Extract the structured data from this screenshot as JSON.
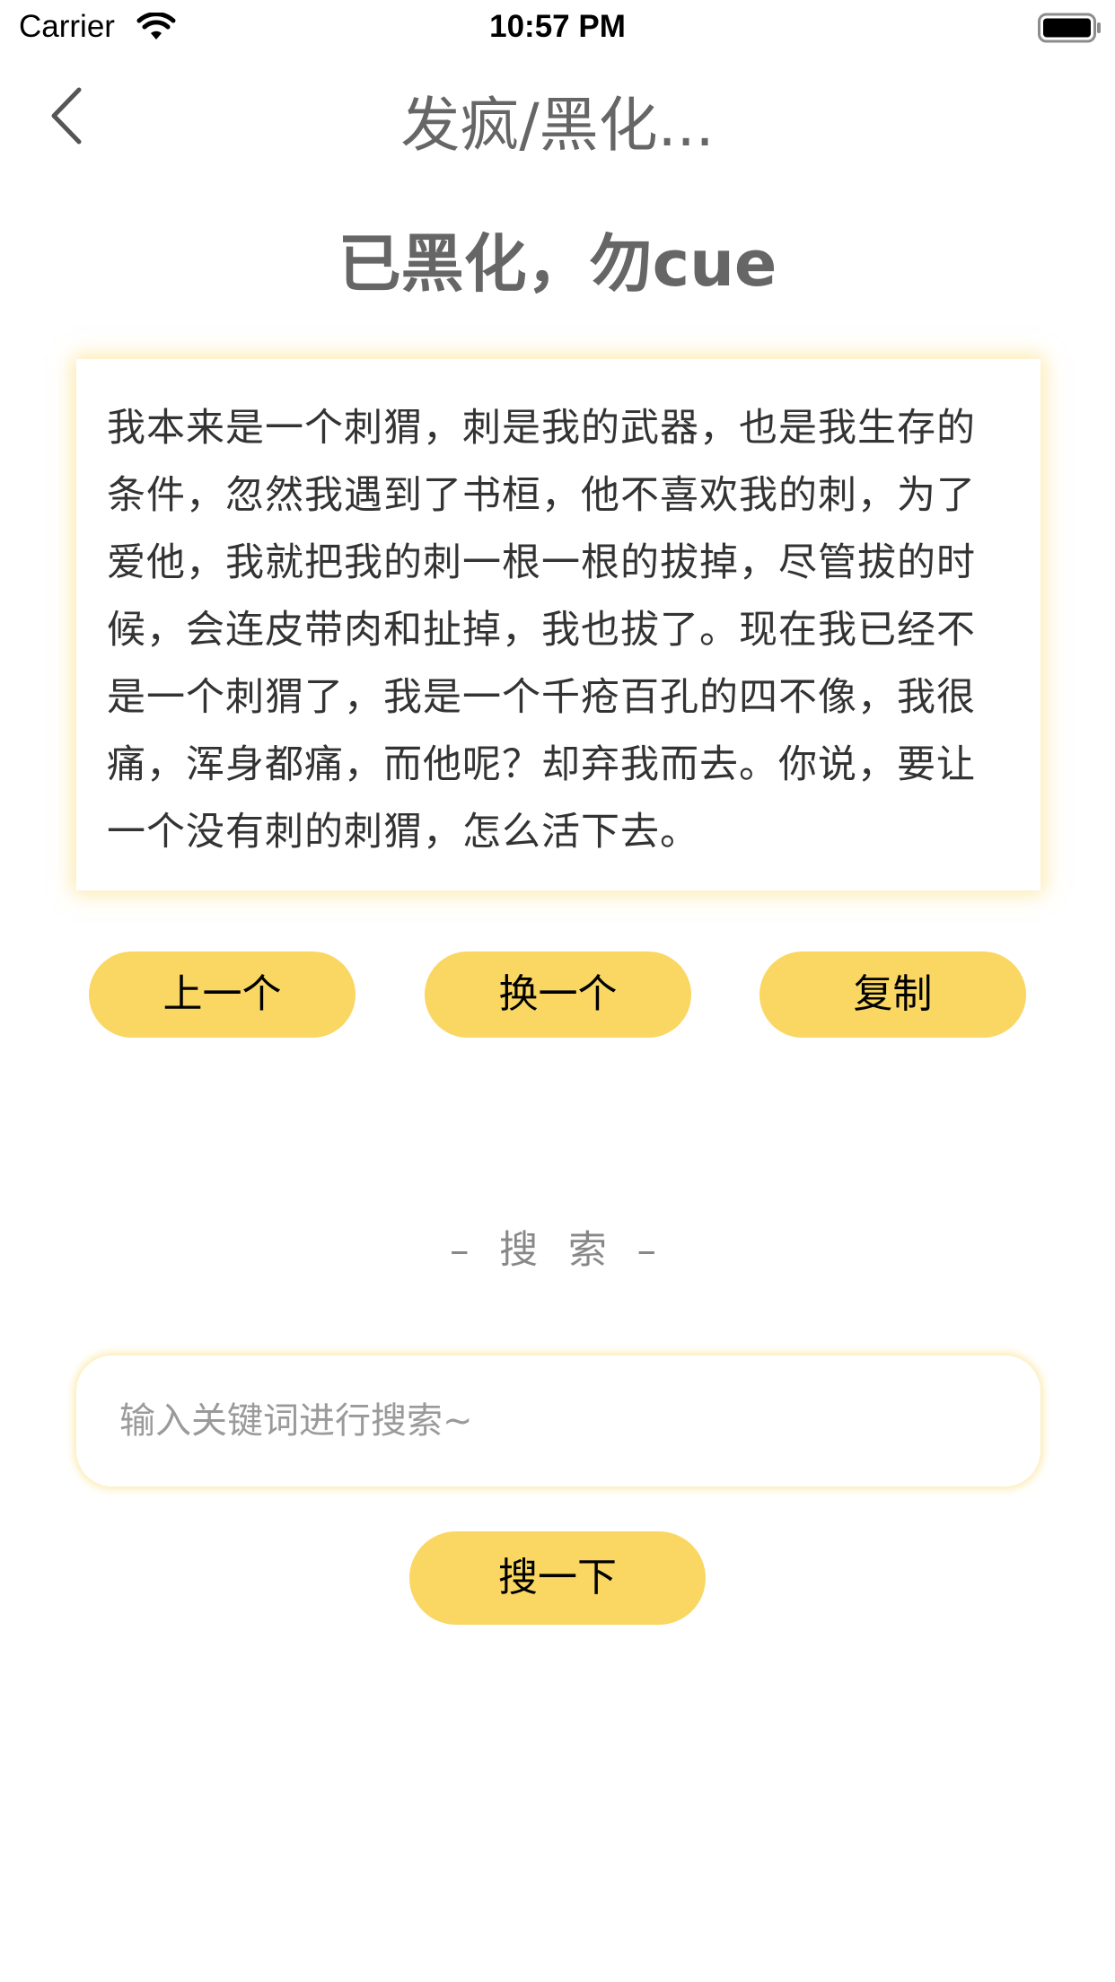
{
  "status_bar": {
    "carrier": "Carrier",
    "time": "10:57 PM"
  },
  "nav": {
    "title": "发疯/黑化...",
    "back_icon": "chevron-left-icon"
  },
  "heading": "已黑化，勿cue",
  "quote": {
    "text": "我本来是一个刺猬，刺是我的武器，也是我生存的条件，忽然我遇到了书桓，他不喜欢我的刺，为了爱他，我就把我的刺一根一根的拔掉，尽管拔的时候，会连皮带肉和扯掉，我也拔了。现在我已经不是一个刺猬了，我是一个千疮百孔的四不像，我很痛，浑身都痛，而他呢？却弃我而去。你说，要让一个没有刺的刺猬，怎么活下去。"
  },
  "actions": {
    "prev": "上一个",
    "next": "换一个",
    "copy": "复制"
  },
  "search": {
    "section_title": "– 搜 索 –",
    "placeholder": "输入关键词进行搜索~",
    "value": "",
    "button": "搜一下"
  },
  "colors": {
    "accent": "#f9d762",
    "title_gray": "#666666",
    "text": "#333333"
  }
}
